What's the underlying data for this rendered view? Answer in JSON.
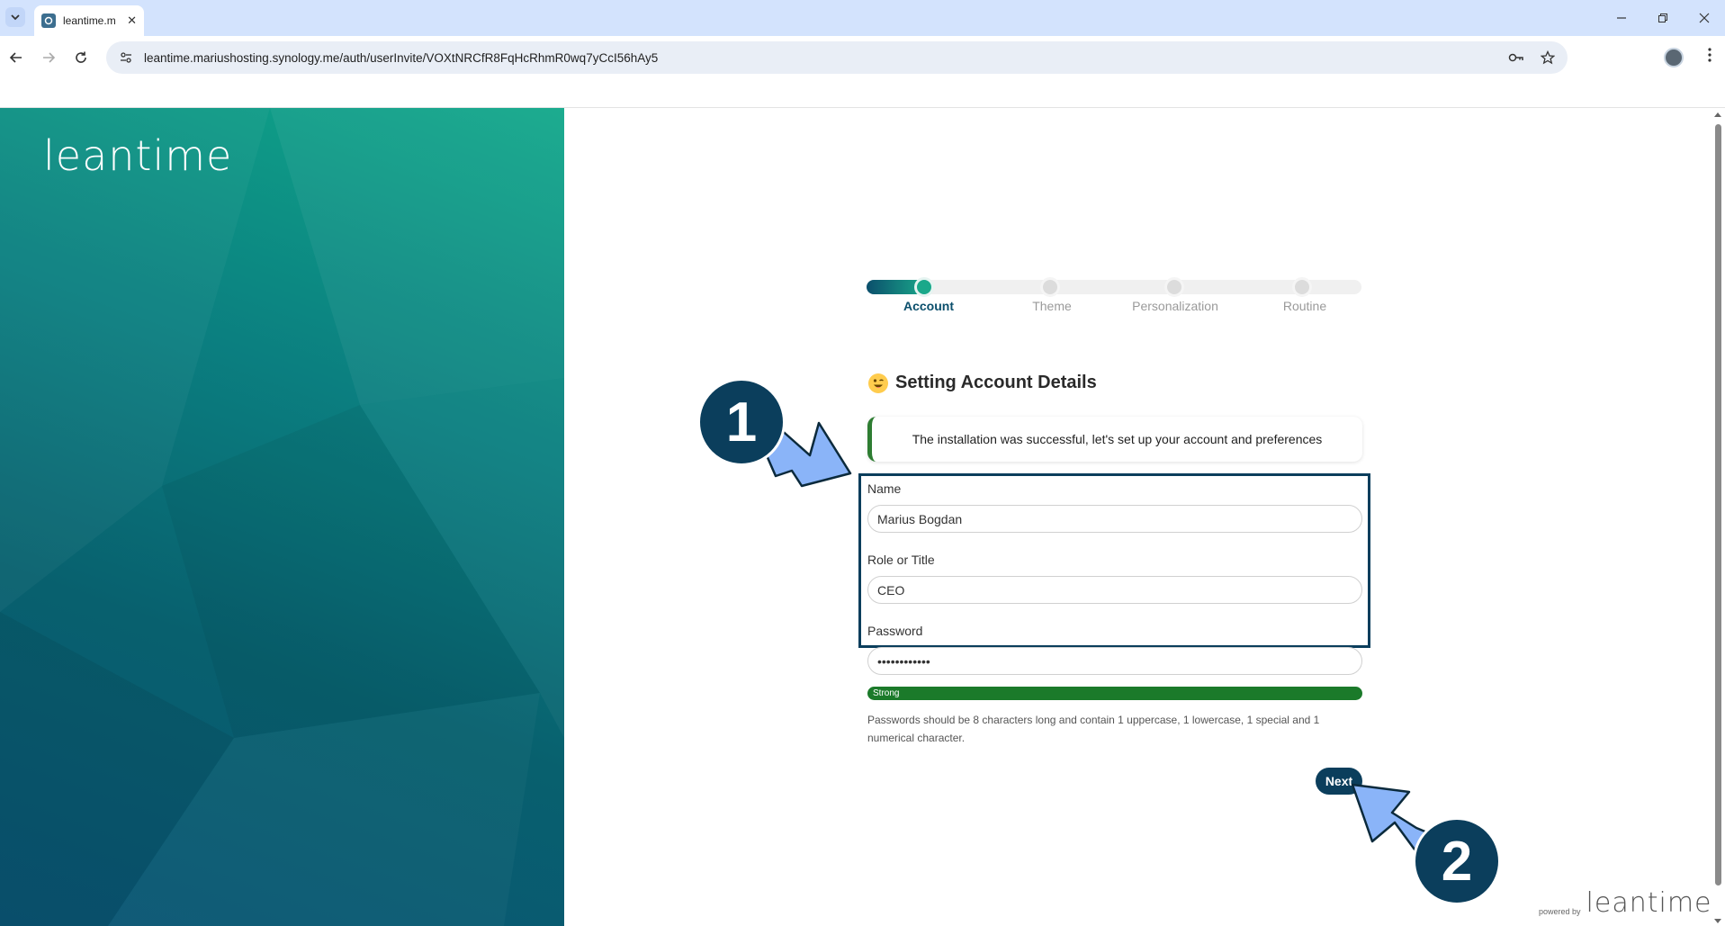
{
  "browser": {
    "tab_title": "leantime.m",
    "url": "leantime.mariushosting.synology.me/auth/userInvite/VOXtNRCfR8FqHcRhmR0wq7yCcI56hAy5"
  },
  "brand": {
    "logo_text": "leantime",
    "powered_by": "powered by",
    "powered_logo": "leantime"
  },
  "stepper": {
    "steps": [
      {
        "label": "Account"
      },
      {
        "label": "Theme"
      },
      {
        "label": "Personalization"
      },
      {
        "label": "Routine"
      }
    ],
    "active_index": 0
  },
  "form": {
    "title": "Setting Account Details",
    "alert": "The installation was successful, let's set up your account and preferences",
    "name_label": "Name",
    "name_value": "Marius Bogdan",
    "role_label": "Role or Title",
    "role_value": "CEO",
    "password_label": "Password",
    "password_value": "••••••••••••",
    "strength_label": "Strong",
    "password_hint": "Passwords should be 8 characters long and contain 1 uppercase, 1 lowercase, 1 special and 1 numerical character.",
    "next_label": "Next"
  },
  "annotations": {
    "badge1": "1",
    "badge2": "2"
  },
  "colors": {
    "primary": "#0b3e5c",
    "accent": "#1aa88a",
    "success": "#1b7a2a",
    "arrow": "#8ab4f8"
  }
}
